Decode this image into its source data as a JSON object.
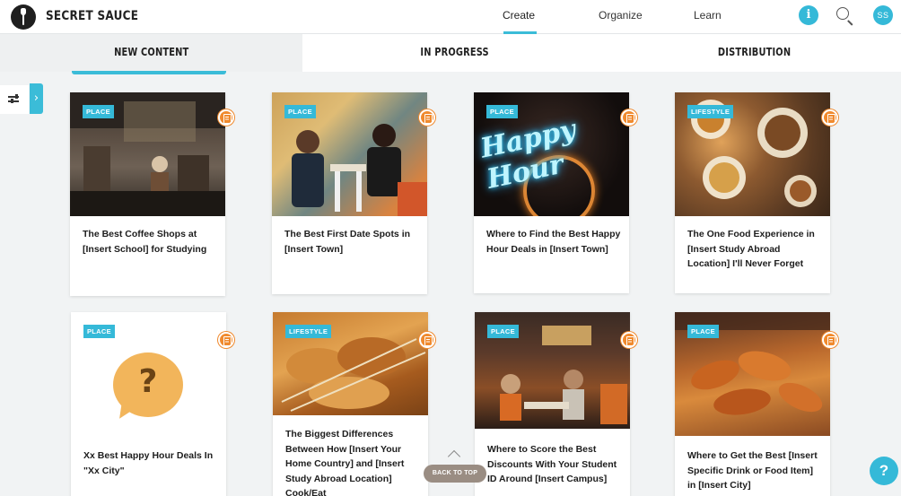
{
  "brand": {
    "name": "SECRET SAUCE",
    "logo_icon": "spoon-logo-icon"
  },
  "nav": [
    {
      "label": "Create",
      "active": true
    },
    {
      "label": "Organize",
      "active": false
    },
    {
      "label": "Learn",
      "active": false
    }
  ],
  "header_actions": {
    "info_label": "i",
    "search_icon": "search-icon",
    "avatar_initials": "SS"
  },
  "tabs": [
    {
      "label": "NEW CONTENT",
      "active": true
    },
    {
      "label": "IN PROGRESS",
      "active": false
    },
    {
      "label": "DISTRIBUTION",
      "active": false
    }
  ],
  "filter": {
    "icon": "sliders-icon",
    "expand_icon": "chevron-right-icon",
    "expand_glyph": "›"
  },
  "cards": [
    {
      "tag": "PLACE",
      "title": "The Best Coffee Shops at [Insert School] for Studying",
      "image": "cafe interior",
      "doc_icon": "document-icon"
    },
    {
      "tag": "PLACE",
      "title": "The Best First Date Spots in [Insert Town]",
      "image": "couple at table",
      "doc_icon": "document-icon"
    },
    {
      "tag": "PLACE",
      "title": "Where to Find the Best Happy Hour Deals in [Insert Town]",
      "image": "neon sign",
      "neon_text": "Happy Hour",
      "doc_icon": "document-icon"
    },
    {
      "tag": "LIFESTYLE",
      "title": "The One Food Experience in [Insert Study Abroad Location] I'll Never Forget",
      "image": "food table",
      "doc_icon": "document-icon"
    },
    {
      "tag": "PLACE",
      "title": "Xx Best Happy Hour Deals In \"Xx City\"",
      "image": "question bubble",
      "placeholder_glyph": "?",
      "doc_icon": "document-icon"
    },
    {
      "tag": "LIFESTYLE",
      "title": "The Biggest Differences Between How [Insert Your Home Country] and [Insert Study Abroad Location] Cook/Eat",
      "image": "fried skewers",
      "doc_icon": "document-icon"
    },
    {
      "tag": "PLACE",
      "title": "Where to Score the Best Discounts With Your Student ID Around [Insert Campus]",
      "image": "restaurant patio",
      "doc_icon": "document-icon"
    },
    {
      "tag": "PLACE",
      "title": "Where to Get the Best [Insert Specific Drink or Food Item] in [Insert City]",
      "image": "chicken wings",
      "doc_icon": "document-icon"
    }
  ],
  "back_to_top": {
    "label": "BACK TO TOP",
    "icon": "chevron-up-icon"
  },
  "help": {
    "label": "?",
    "icon": "help-icon"
  },
  "colors": {
    "accent": "#3bbcd8",
    "doc_icon": "#f08a2e",
    "page_bg": "#f1f3f4"
  }
}
